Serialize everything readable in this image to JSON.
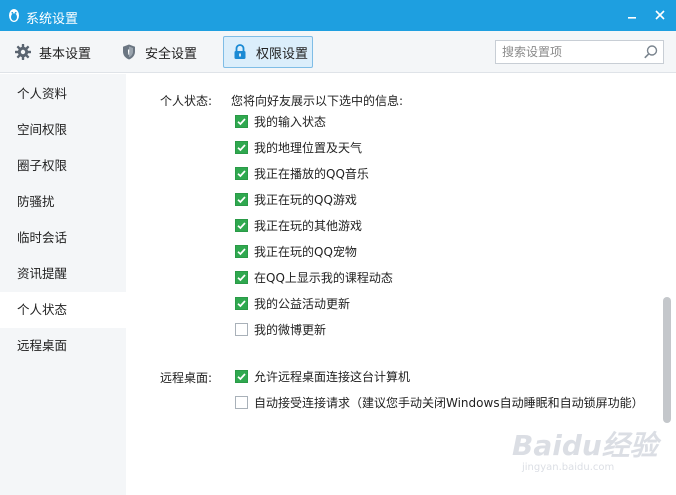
{
  "window": {
    "title": "系统设置",
    "app_icon": "qq-penguin-icon",
    "accent_color": "#1e9fe0"
  },
  "toolbar": {
    "tabs": [
      {
        "label": "基本设置",
        "icon": "gear-icon"
      },
      {
        "label": "安全设置",
        "icon": "shield-icon"
      },
      {
        "label": "权限设置",
        "icon": "lock-icon",
        "active": true
      }
    ],
    "search": {
      "placeholder": "搜索设置项",
      "value": ""
    }
  },
  "sidebar": {
    "items": [
      {
        "label": "个人资料"
      },
      {
        "label": "空间权限"
      },
      {
        "label": "圈子权限"
      },
      {
        "label": "防骚扰"
      },
      {
        "label": "临时会话"
      },
      {
        "label": "资讯提醒"
      },
      {
        "label": "个人状态",
        "active": true
      },
      {
        "label": "远程桌面"
      }
    ]
  },
  "personal_status": {
    "label": "个人状态:",
    "description": "您将向好友展示以下选中的信息:",
    "options": [
      {
        "label": "我的输入状态",
        "checked": true
      },
      {
        "label": "我的地理位置及天气",
        "checked": true
      },
      {
        "label": "我正在播放的QQ音乐",
        "checked": true
      },
      {
        "label": "我正在玩的QQ游戏",
        "checked": true
      },
      {
        "label": "我正在玩的其他游戏",
        "checked": true
      },
      {
        "label": "我正在玩的QQ宠物",
        "checked": true
      },
      {
        "label": "在QQ上显示我的课程动态",
        "checked": true
      },
      {
        "label": "我的公益活动更新",
        "checked": true
      },
      {
        "label": "我的微博更新",
        "checked": false
      }
    ]
  },
  "remote_desktop": {
    "label": "远程桌面:",
    "options": [
      {
        "label": "允许远程桌面连接这台计算机",
        "checked": true
      },
      {
        "label": "自动接受连接请求（建议您手动关闭Windows自动睡眠和自动锁屏功能）",
        "checked": false
      }
    ]
  },
  "watermark": {
    "main": "Baidu经验",
    "sub": "jingyan.baidu.com"
  }
}
